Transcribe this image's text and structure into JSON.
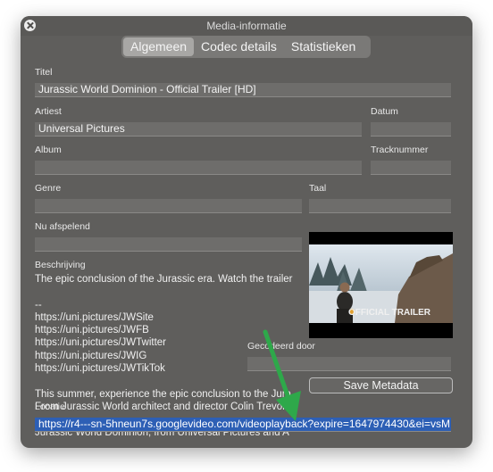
{
  "window": {
    "title": "Media-informatie"
  },
  "tabs": [
    {
      "label": "Algemeen",
      "active": true
    },
    {
      "label": "Codec details",
      "active": false
    },
    {
      "label": "Statistieken",
      "active": false
    }
  ],
  "fields": {
    "title_label": "Titel",
    "title_value": "Jurassic World Dominion - Official Trailer [HD]",
    "artist_label": "Artiest",
    "artist_value": "Universal Pictures",
    "date_label": "Datum",
    "date_value": "",
    "album_label": "Album",
    "album_value": "",
    "track_label": "Tracknummer",
    "track_value": "",
    "genre_label": "Genre",
    "genre_value": "",
    "language_label": "Taal",
    "language_value": "",
    "now_playing_label": "Nu afspelend",
    "now_playing_value": "",
    "description_label": "Beschrijving",
    "encoded_by_label": "Gecodeerd door",
    "encoded_by_value": "",
    "location_label": "Locatie",
    "location_value": "https://r4---sn-5hneun7s.googlevideo.com/videoplayback?expire=1647974430&ei=vsM"
  },
  "description_lines": [
    "The epic conclusion of the Jurassic era. Watch the trailer",
    "",
    "--",
    "https://uni.pictures/JWSite",
    "https://uni.pictures/JWFB",
    "https://uni.pictures/JWTwitter",
    "https://uni.pictures/JWIG",
    "https://uni.pictures/JWTikTok",
    "",
    "This summer, experience the epic conclusion to the Jura",
    "From Jurassic World architect and director Colin Trevorr",
    "",
    "Jurassic World Dominion, from Universal Pictures and A"
  ],
  "artwork": {
    "caption": "OFFICIAL TRAILER"
  },
  "buttons": {
    "save_metadata": "Save Metadata"
  },
  "colors": {
    "window_bg": "#5f5e5c",
    "selection": "#2d5fb5",
    "annotation_arrow": "#2ea84a"
  }
}
